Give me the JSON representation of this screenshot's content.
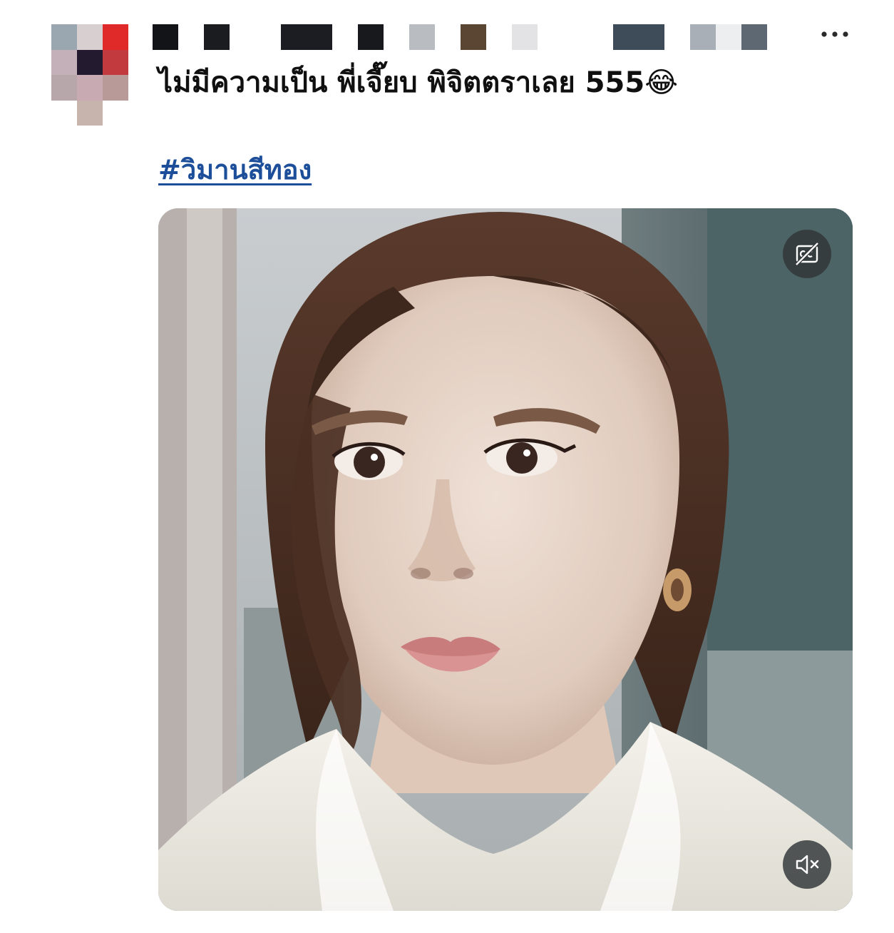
{
  "post": {
    "text": "ไม่มีความเป็น พี่เจี๊ยบ พิจิตตราเลย 555😂",
    "hashtag": "#วิมานสีทอง"
  },
  "icons": {
    "more": "more-horizontal-icon",
    "captions": "captions-off-icon",
    "mute": "volume-muted-icon"
  },
  "colors": {
    "hashtag": "#1d4e9a",
    "text": "#101010",
    "overlay_button": "#303437"
  }
}
